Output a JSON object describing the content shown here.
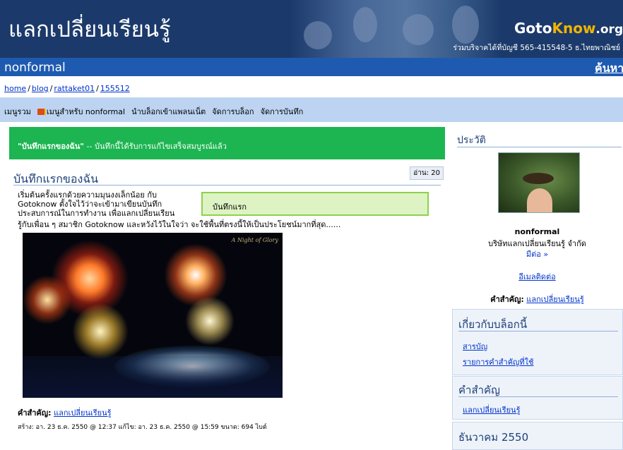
{
  "header": {
    "site_title": "แลกเปลี่ยนเรียนรู้",
    "logo": {
      "part1": "Goto",
      "part2": "Know",
      "part3": ".org"
    },
    "donate_text": "ร่วมบริจาคได้ที่บัญชี 565-415548-5 ธ.ไทยพาณิชย์"
  },
  "community_bar": {
    "name": "nonformal",
    "search_link": "ค้นหา"
  },
  "breadcrumb": [
    "home",
    "blog",
    "rattaket01",
    "155512"
  ],
  "menu": [
    "เมนูรวม",
    "เมนูสำหรับ nonformal",
    "นำบล็อกเข้าแพลนเน็ต",
    "จัดการบล็อก",
    "จัดการบันทึก"
  ],
  "notice": {
    "title": "\"บันทึกแรกของฉัน\"",
    "message": " -- บันทึกนี้ได้รับการแก้ไขเสร็จสมบูรณ์แล้ว"
  },
  "entry": {
    "view_count": "อ่าน: 20",
    "title": "บันทึกแรกของฉัน",
    "intro_lines": [
      "เริ่มต้นครั้งแรกด้วยความมุนงงเล็กน้อย กับ",
      "Gotoknow ตั้งใจไว้ว่าจะเข้ามาเขียนบันทึก",
      "ประสบการณ์ในการทำงาน เพื่อแลกเปลี่ยนเรียน"
    ],
    "intro_last_line": "รู้กับเพื่อน ๆ สมาชิก Gotoknow  และหวังไว้ในใจว่า จะใช้พื้นที่ตรงนี้ให้เป็นประโยชน์มากที่สุด......",
    "quote": "บันทึกแรก",
    "photo_caption": "A Night of Glory",
    "tags_label": "คำสำคัญ:",
    "tag": "แลกเปลี่ยนเรียนรู้",
    "meta": "สร้าง: อา. 23 ธ.ค. 2550 @ 12:37   แก้ไข: อา. 23 ธ.ค. 2550 @ 15:59   ขนาด: 694 ไบต์"
  },
  "sidebar": {
    "profile_heading": "ประวัติ",
    "name": "nonformal",
    "org": "บริษัทแลกเปลี่ยนเรียนรู้ จำกัด",
    "more": "มีต่อ »",
    "email_link": "อีเมลติดต่อ",
    "keywords_label": "คำสำคัญ:",
    "keyword": "แลกเปลี่ยนเรียนรู้",
    "about_heading": "เกี่ยวกับบล็อกนี้",
    "about_links": [
      "สารบัญ",
      "รายการคำสำคัญที่ใช้"
    ],
    "kw_heading": "คำสำคัญ",
    "kw_links": [
      "แลกเปลี่ยนเรียนรู้"
    ],
    "month_heading": "ธันวาคม 2550"
  },
  "colors": {
    "banner": "#1b3a6b",
    "community_bar": "#1e5bb0",
    "menubar": "#bcd4f1",
    "notice": "#1cb551",
    "quote_bg": "#ddf3c3"
  }
}
